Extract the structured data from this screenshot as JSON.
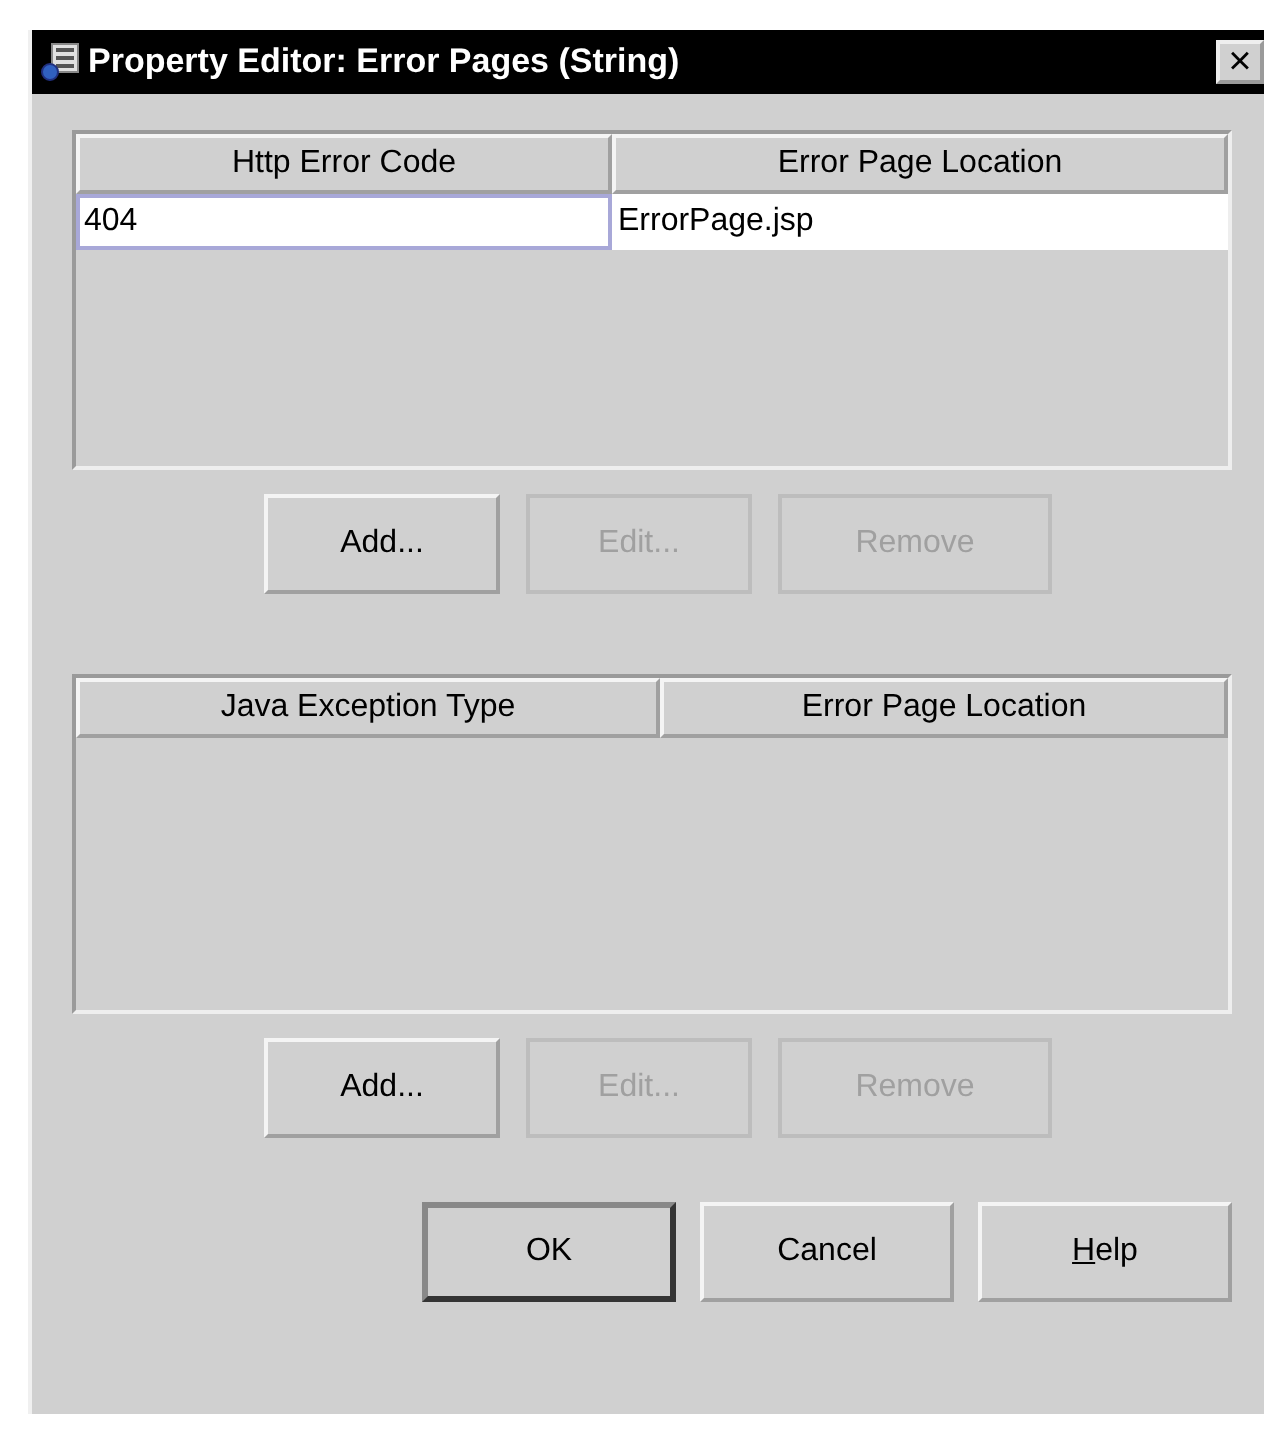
{
  "window": {
    "title": "Property Editor: Error Pages (String)",
    "close": "×"
  },
  "tables": [
    {
      "columns": [
        "Http Error Code",
        "Error Page Location"
      ],
      "rows": [
        {
          "cells": [
            "404",
            "ErrorPage.jsp"
          ],
          "selected": true
        }
      ],
      "buttons": [
        {
          "label": "Add...",
          "disabled": false
        },
        {
          "label": "Edit...",
          "disabled": true
        },
        {
          "label": "Remove",
          "disabled": true
        }
      ]
    },
    {
      "columns": [
        "Java Exception Type",
        "Error Page Location"
      ],
      "buttons": [
        {
          "label": "Add...",
          "disabled": false
        },
        {
          "label": "Edit...",
          "disabled": true
        },
        {
          "label": "Remove",
          "disabled": true
        }
      ]
    }
  ],
  "dialog_buttons": [
    {
      "label": "OK",
      "default": true,
      "underline_first": false
    },
    {
      "label": "Cancel",
      "default": false,
      "underline_first": false
    },
    {
      "label": "Help",
      "default": false,
      "underline_first": true
    }
  ]
}
